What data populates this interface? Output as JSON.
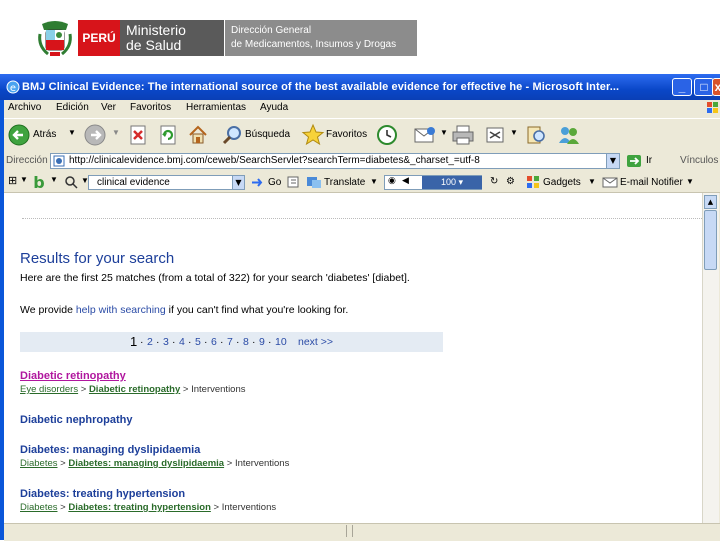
{
  "banner": {
    "peru": "PERÚ",
    "ministry_line1": "Ministerio",
    "ministry_line2": "de Salud",
    "direction_line1": "Dirección General",
    "direction_line2": "de Medicamentos, Insumos y Drogas"
  },
  "window": {
    "title": "BMJ Clinical Evidence: The international source of the best available evidence for effective he - Microsoft Inter...",
    "min": "_",
    "max": "□",
    "close": "x"
  },
  "menu": [
    "Archivo",
    "Edición",
    "Ver",
    "Favoritos",
    "Herramientas",
    "Ayuda"
  ],
  "toolbar": {
    "back": "Atrás",
    "search": "Búsqueda",
    "favorites": "Favoritos"
  },
  "address": {
    "label": "Dirección",
    "url": "http://clinicalevidence.bmj.com/ceweb/SearchServlet?searchTerm=diabetes&_charset_=utf-8",
    "go": "Ir",
    "links": "Vínculos"
  },
  "googlebar": {
    "search_value": "clinical evidence",
    "go": "Go",
    "translate": "Translate",
    "zoom": "100",
    "gadgets": "Gadgets",
    "email": "E-mail Notifier"
  },
  "content": {
    "heading": "Results for your search",
    "summary": "Here are the first 25 matches (from a total of 322) for your search 'diabetes' [diabet].",
    "help_prefix": "We provide ",
    "help_link": "help with searching",
    "help_suffix": " if you can't find what you're looking for.",
    "pager_current": "1",
    "pager_pages": [
      "2",
      "3",
      "4",
      "5",
      "6",
      "7",
      "8",
      "9",
      "10"
    ],
    "pager_next": "next >>",
    "results": [
      {
        "title": "Diabetic retinopathy",
        "crumbs": [
          "Eye disorders",
          "Diabetic retinopathy",
          "Interventions"
        ],
        "visited": true
      },
      {
        "title": "Diabetic nephropathy",
        "crumbs": [],
        "visited": false
      },
      {
        "title": "Diabetes: managing dyslipidaemia",
        "crumbs": [
          "Diabetes",
          "Diabetes: managing dyslipidaemia",
          "Interventions"
        ],
        "visited": false
      },
      {
        "title": "Diabetes: treating hypertension",
        "crumbs": [
          "Diabetes",
          "Diabetes: treating hypertension",
          "Interventions"
        ],
        "visited": false
      }
    ]
  },
  "colors": {
    "title_bar": "#0a47c8",
    "heading": "#1d3f9a",
    "visited": "#b0169e",
    "crumb_link": "#2a6b2a",
    "peru_red": "#d7141a"
  }
}
